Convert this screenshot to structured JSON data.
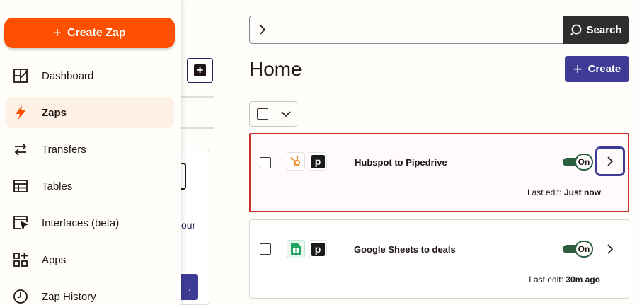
{
  "sidebar": {
    "create_label": "Create Zap",
    "items": [
      {
        "label": "Dashboard",
        "icon": "dashboard-icon"
      },
      {
        "label": "Zaps",
        "icon": "lightning-icon",
        "active": true
      },
      {
        "label": "Transfers",
        "icon": "transfer-arrows-icon"
      },
      {
        "label": "Tables",
        "icon": "table-icon"
      },
      {
        "label": "Interfaces (beta)",
        "icon": "interface-cursor-icon"
      },
      {
        "label": "Apps",
        "icon": "apps-grid-icon"
      },
      {
        "label": "Zap History",
        "icon": "clock-icon"
      }
    ]
  },
  "middle": {
    "partial_text": "our"
  },
  "search": {
    "value": "",
    "placeholder": "",
    "button_label": "Search"
  },
  "main": {
    "title": "Home",
    "create_label": "Create"
  },
  "zaps": [
    {
      "name": "Hubspot to Pipedrive",
      "apps": [
        "hubspot-icon",
        "pipedrive-icon"
      ],
      "status": "On",
      "last_edit_label": "Last edit:",
      "last_edit_value": "Just now",
      "highlighted": true
    },
    {
      "name": "Google Sheets to deals",
      "apps": [
        "google-sheets-icon",
        "pipedrive-icon"
      ],
      "status": "On",
      "last_edit_label": "Last edit:",
      "last_edit_value": "30m ago",
      "highlighted": false
    }
  ],
  "colors": {
    "brand_orange": "#ff4f00",
    "primary_purple": "#3d3b94",
    "toggle_green": "#2a5e3d",
    "highlight_red": "#c9302c"
  }
}
